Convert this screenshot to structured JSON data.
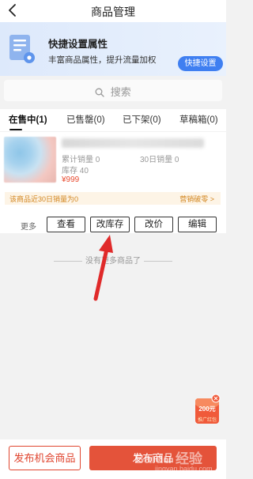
{
  "header": {
    "title": "商品管理"
  },
  "banner": {
    "title": "快捷设置属性",
    "subtitle": "丰富商品属性，提升流量加权",
    "button_label": "快捷设置",
    "accent_color": "#3f7ff1"
  },
  "search": {
    "placeholder": "搜索"
  },
  "tabs": [
    {
      "label": "在售中(1)",
      "active": true
    },
    {
      "label": "已售罄(0)"
    },
    {
      "label": "已下架(0)"
    },
    {
      "label": "草稿箱(0)"
    }
  ],
  "product": {
    "sales_total": "累计销量 0",
    "sales_30d": "30日销量 0",
    "stock": "库存 40",
    "price": "¥999",
    "notice": "该商品近30日销量为0",
    "notice_action": "营销破零 >",
    "more_label": "更多",
    "actions": [
      "查看",
      "改库存",
      "改价",
      "编辑"
    ]
  },
  "list_end_text": "没有更多商品了",
  "promo_badge": {
    "amount": "200元",
    "caption": "推广红包"
  },
  "footer": {
    "left_button": "发布机会商品",
    "right_button": "发布商品",
    "brand_color": "#e4533a"
  },
  "watermark": {
    "text": "Baidu 经验",
    "sub": "jingyan.baidu.com"
  }
}
